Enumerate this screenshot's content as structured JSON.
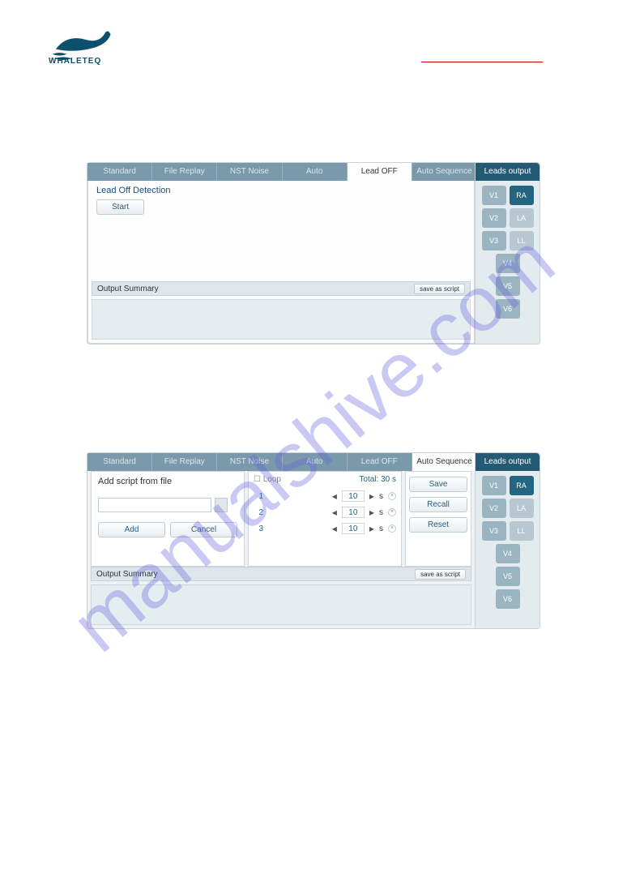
{
  "logo_text": "WHALETEQ",
  "watermark": "manualshive.com",
  "tabs": {
    "standard": "Standard",
    "file_replay": "File Replay",
    "nst_noise": "NST Noise",
    "auto": "Auto",
    "lead_off": "Lead OFF",
    "auto_sequence": "Auto Sequence"
  },
  "leads": {
    "header": "Leads output",
    "v1": "V1",
    "v2": "V2",
    "v3": "V3",
    "v4": "V4",
    "v5": "V5",
    "v6": "V6",
    "ra": "RA",
    "la": "LA",
    "ll": "LL"
  },
  "panel1": {
    "section_title": "Lead Off Detection",
    "start_btn": "Start",
    "output_summary": "Output Summary",
    "save_as_script": "save as script"
  },
  "panel2": {
    "add_script_title": "Add script from file",
    "add_btn": "Add",
    "cancel_btn": "Cancel",
    "loop_label": "Loop",
    "total_label": "Total:",
    "total_value": "30 s",
    "rows": [
      {
        "n": "1",
        "val": "10",
        "unit": "s"
      },
      {
        "n": "2",
        "val": "10",
        "unit": "s"
      },
      {
        "n": "3",
        "val": "10",
        "unit": "s"
      }
    ],
    "save_btn": "Save",
    "recall_btn": "Recall",
    "reset_btn": "Reset",
    "output_summary": "Output Summary",
    "save_as_script": "save as script"
  }
}
